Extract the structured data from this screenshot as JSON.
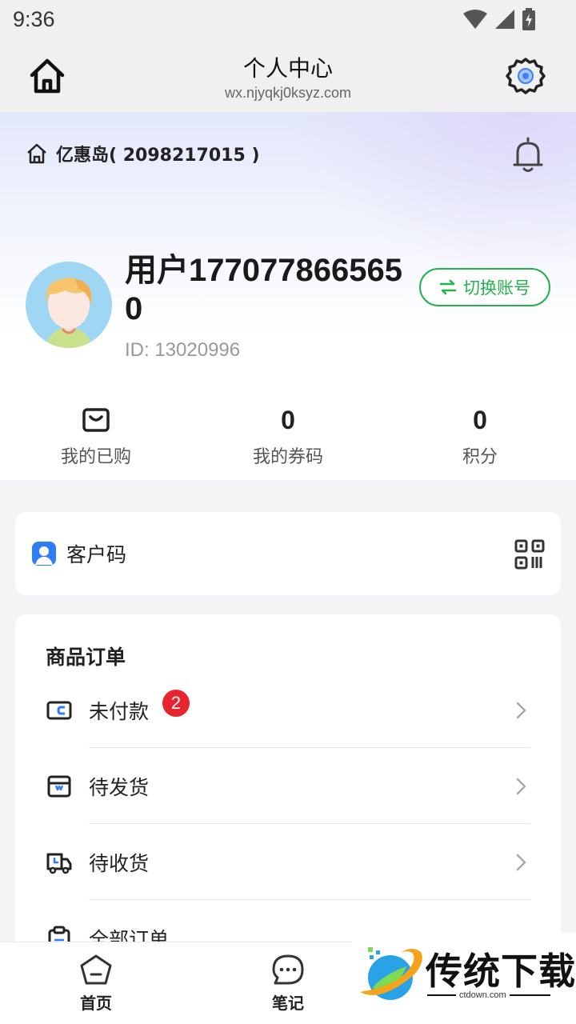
{
  "status_bar": {
    "time": "9:36"
  },
  "app_bar": {
    "title": "个人中心",
    "subtitle": "wx.njyqkj0ksyz.com"
  },
  "shop": {
    "name": "亿惠岛( 2098217015 )"
  },
  "profile": {
    "username": "用户1770778665650",
    "id_text": "ID: 13020996",
    "switch_label": "切换账号"
  },
  "stats": [
    {
      "label": "我的已购",
      "value": ""
    },
    {
      "label": "我的券码",
      "value": "0"
    },
    {
      "label": "积分",
      "value": "0"
    }
  ],
  "customer_code": {
    "label": "客户码"
  },
  "orders": {
    "title": "商品订单",
    "items": [
      {
        "label": "未付款",
        "badge": "2"
      },
      {
        "label": "待发货"
      },
      {
        "label": "待收货"
      },
      {
        "label": "全部订单"
      }
    ]
  },
  "bottom_nav": [
    {
      "label": "首页"
    },
    {
      "label": "笔记"
    }
  ],
  "watermark": {
    "text": "传统下载",
    "url": "ctdown.com"
  },
  "colors": {
    "accent_green": "#22b14c",
    "badge_red": "#e8242e",
    "code_blue": "#2f7cf6"
  }
}
